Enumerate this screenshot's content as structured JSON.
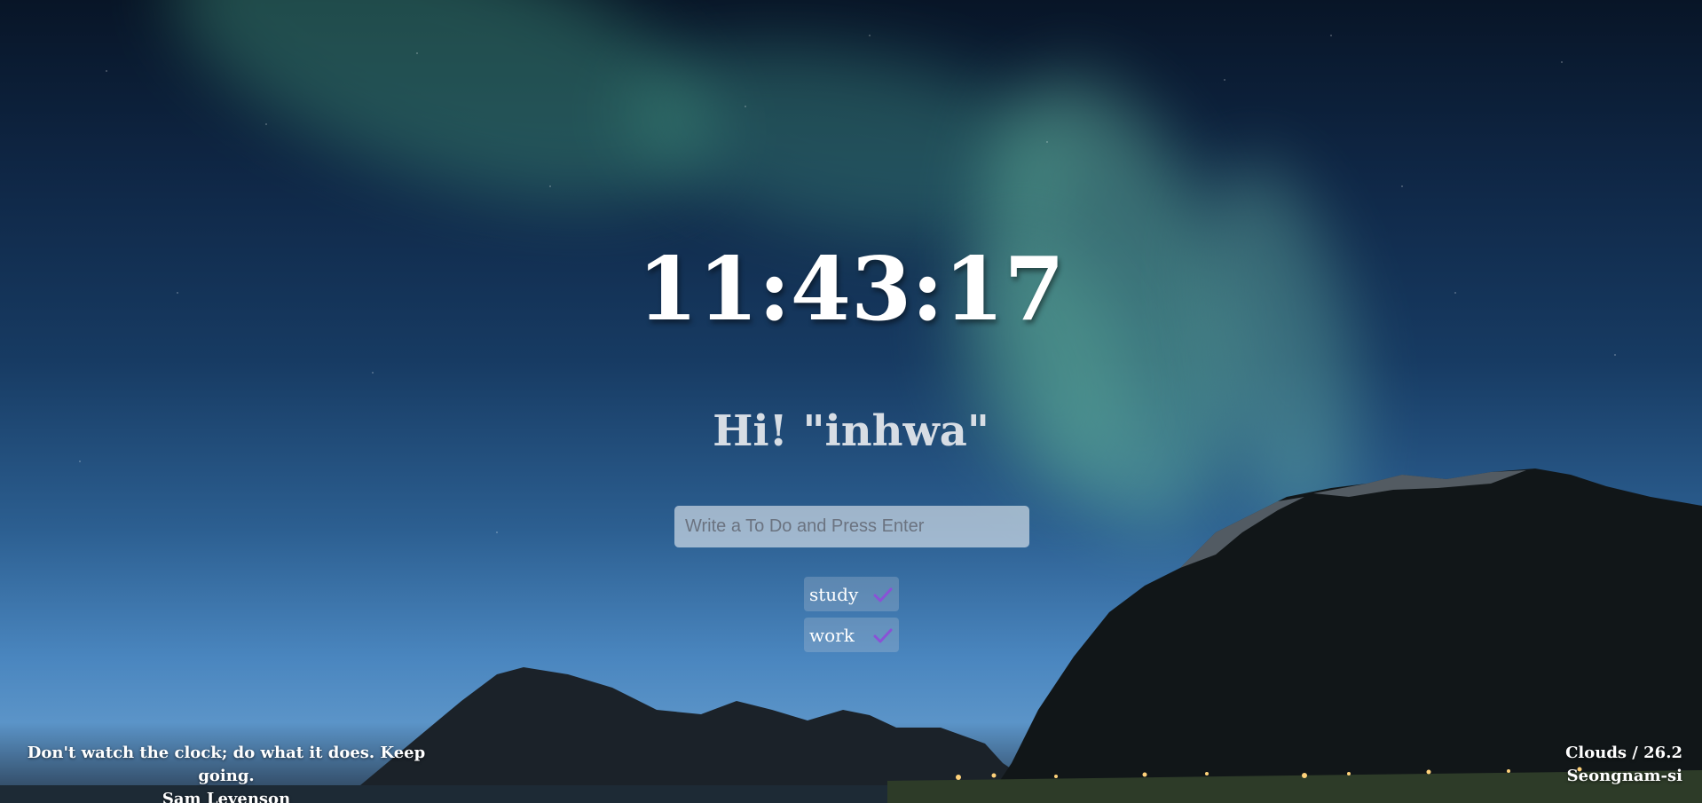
{
  "clock": {
    "time": "11:43:17"
  },
  "greeting": {
    "text": "Hi! \"inhwa\""
  },
  "todo_form": {
    "placeholder": "Write a To Do and Press Enter",
    "value": ""
  },
  "todos": [
    {
      "text": "study",
      "icon": "check-icon"
    },
    {
      "text": "work",
      "icon": "check-icon"
    }
  ],
  "quote": {
    "text": "Don't watch the clock; do what it does. Keep going.",
    "author": "Sam Levenson"
  },
  "weather": {
    "summary": "Clouds / 26.2",
    "city": "Seongnam-si"
  },
  "colors": {
    "check_icon": "#8a52d6",
    "input_background": "rgba(255,255,255,0.55)"
  }
}
